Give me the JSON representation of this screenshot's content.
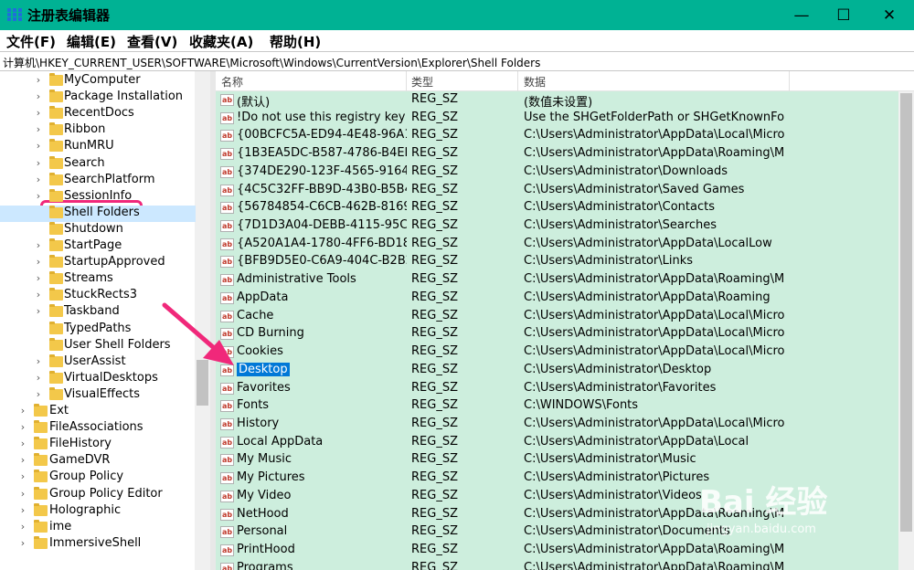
{
  "window": {
    "title": "注册表编辑器",
    "controls": {
      "minimize": "—",
      "maximize": "☐",
      "close": "✕"
    }
  },
  "menu": [
    "文件(F)",
    "编辑(E)",
    "查看(V)",
    "收藏夹(A)",
    "帮助(H)"
  ],
  "address": "计算机\\HKEY_CURRENT_USER\\SOFTWARE\\Microsoft\\Windows\\CurrentVersion\\Explorer\\Shell Folders",
  "tree": {
    "items": [
      {
        "label": "MyComputer",
        "expandable": true
      },
      {
        "label": "Package Installation",
        "expandable": true
      },
      {
        "label": "RecentDocs",
        "expandable": true
      },
      {
        "label": "Ribbon",
        "expandable": true
      },
      {
        "label": "RunMRU",
        "expandable": true
      },
      {
        "label": "Search",
        "expandable": true
      },
      {
        "label": "SearchPlatform",
        "expandable": true
      },
      {
        "label": "SessionInfo",
        "expandable": true
      },
      {
        "label": "Shell Folders",
        "expandable": false,
        "selected": true
      },
      {
        "label": "Shutdown",
        "expandable": false
      },
      {
        "label": "StartPage",
        "expandable": true
      },
      {
        "label": "StartupApproved",
        "expandable": true
      },
      {
        "label": "Streams",
        "expandable": true
      },
      {
        "label": "StuckRects3",
        "expandable": true
      },
      {
        "label": "Taskband",
        "expandable": true
      },
      {
        "label": "TypedPaths",
        "expandable": false
      },
      {
        "label": "User Shell Folders",
        "expandable": false
      },
      {
        "label": "UserAssist",
        "expandable": true
      },
      {
        "label": "VirtualDesktops",
        "expandable": true
      },
      {
        "label": "VisualEffects",
        "expandable": true
      },
      {
        "label": "Ext",
        "expandable": true,
        "level": 1
      },
      {
        "label": "FileAssociations",
        "expandable": true,
        "level": 1
      },
      {
        "label": "FileHistory",
        "expandable": true,
        "level": 1
      },
      {
        "label": "GameDVR",
        "expandable": true,
        "level": 1
      },
      {
        "label": "Group Policy",
        "expandable": true,
        "level": 1
      },
      {
        "label": "Group Policy Editor",
        "expandable": true,
        "level": 1
      },
      {
        "label": "Holographic",
        "expandable": true,
        "level": 1
      },
      {
        "label": "ime",
        "expandable": true,
        "level": 1
      },
      {
        "label": "ImmersiveShell",
        "expandable": true,
        "level": 1
      }
    ]
  },
  "list": {
    "headers": {
      "name": "名称",
      "type": "类型",
      "data": "数据"
    },
    "rows": [
      {
        "name": "(默认)",
        "type": "REG_SZ",
        "data": "(数值未设置)"
      },
      {
        "name": "!Do not use this registry key",
        "type": "REG_SZ",
        "data": "Use the SHGetFolderPath or SHGetKnownFol..."
      },
      {
        "name": "{00BCFC5A-ED94-4E48-96A1...",
        "type": "REG_SZ",
        "data": "C:\\Users\\Administrator\\AppData\\Local\\Micro..."
      },
      {
        "name": "{1B3EA5DC-B587-4786-B4EF-...",
        "type": "REG_SZ",
        "data": "C:\\Users\\Administrator\\AppData\\Roaming\\Mi..."
      },
      {
        "name": "{374DE290-123F-4565-9164-...",
        "type": "REG_SZ",
        "data": "C:\\Users\\Administrator\\Downloads"
      },
      {
        "name": "{4C5C32FF-BB9D-43B0-B5B4-...",
        "type": "REG_SZ",
        "data": "C:\\Users\\Administrator\\Saved Games"
      },
      {
        "name": "{56784854-C6CB-462B-8169-...",
        "type": "REG_SZ",
        "data": "C:\\Users\\Administrator\\Contacts"
      },
      {
        "name": "{7D1D3A04-DEBB-4115-95CF...",
        "type": "REG_SZ",
        "data": "C:\\Users\\Administrator\\Searches"
      },
      {
        "name": "{A520A1A4-1780-4FF6-BD18...",
        "type": "REG_SZ",
        "data": "C:\\Users\\Administrator\\AppData\\LocalLow"
      },
      {
        "name": "{BFB9D5E0-C6A9-404C-B2B2-...",
        "type": "REG_SZ",
        "data": "C:\\Users\\Administrator\\Links"
      },
      {
        "name": "Administrative Tools",
        "type": "REG_SZ",
        "data": "C:\\Users\\Administrator\\AppData\\Roaming\\Mi..."
      },
      {
        "name": "AppData",
        "type": "REG_SZ",
        "data": "C:\\Users\\Administrator\\AppData\\Roaming"
      },
      {
        "name": "Cache",
        "type": "REG_SZ",
        "data": "C:\\Users\\Administrator\\AppData\\Local\\Micro..."
      },
      {
        "name": "CD Burning",
        "type": "REG_SZ",
        "data": "C:\\Users\\Administrator\\AppData\\Local\\Micro..."
      },
      {
        "name": "Cookies",
        "type": "REG_SZ",
        "data": "C:\\Users\\Administrator\\AppData\\Local\\Micro..."
      },
      {
        "name": "Desktop",
        "type": "REG_SZ",
        "data": "C:\\Users\\Administrator\\Desktop",
        "selected": true
      },
      {
        "name": "Favorites",
        "type": "REG_SZ",
        "data": "C:\\Users\\Administrator\\Favorites"
      },
      {
        "name": "Fonts",
        "type": "REG_SZ",
        "data": "C:\\WINDOWS\\Fonts"
      },
      {
        "name": "History",
        "type": "REG_SZ",
        "data": "C:\\Users\\Administrator\\AppData\\Local\\Micro..."
      },
      {
        "name": "Local AppData",
        "type": "REG_SZ",
        "data": "C:\\Users\\Administrator\\AppData\\Local"
      },
      {
        "name": "My Music",
        "type": "REG_SZ",
        "data": "C:\\Users\\Administrator\\Music"
      },
      {
        "name": "My Pictures",
        "type": "REG_SZ",
        "data": "C:\\Users\\Administrator\\Pictures"
      },
      {
        "name": "My Video",
        "type": "REG_SZ",
        "data": "C:\\Users\\Administrator\\Videos"
      },
      {
        "name": "NetHood",
        "type": "REG_SZ",
        "data": "C:\\Users\\Administrator\\AppData\\Roaming\\Mi..."
      },
      {
        "name": "Personal",
        "type": "REG_SZ",
        "data": "C:\\Users\\Administrator\\Documents"
      },
      {
        "name": "PrintHood",
        "type": "REG_SZ",
        "data": "C:\\Users\\Administrator\\AppData\\Roaming\\Mi..."
      },
      {
        "name": "Programs",
        "type": "REG_SZ",
        "data": "C:\\Users\\Administrator\\AppData\\Roaming\\Mi..."
      }
    ]
  },
  "icons": {
    "value_icon_text": "ab",
    "collapsed_chevron": "›"
  },
  "watermark": {
    "logo": "Bai 经验",
    "url": "jingyan.baidu.com"
  },
  "colors": {
    "titlebar": "#00b294",
    "list_background": "#cdeedd",
    "selection": "#0078d7",
    "highlight_box": "#f0287a",
    "arrow": "#f0287a"
  }
}
